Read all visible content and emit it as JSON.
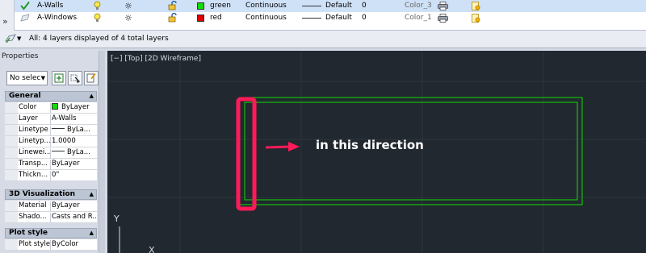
{
  "layers_table": {
    "rows": [
      {
        "name": "A-Walls",
        "color_name": "green",
        "color_hex": "#11dd00",
        "linetype": "Continuous",
        "lineweight": "Default",
        "transparency": "0",
        "plot_style": "Color_3",
        "current": true
      },
      {
        "name": "A-Windows",
        "color_name": "red",
        "color_hex": "#e00000",
        "linetype": "Continuous",
        "lineweight": "Default",
        "transparency": "0",
        "plot_style": "Color_1",
        "current": false
      }
    ],
    "status_text": "All: 4 layers displayed of 4 total layers"
  },
  "properties": {
    "title": "Properties",
    "selection": "No selec",
    "sections": [
      {
        "title": "General",
        "rows": [
          {
            "name": "Color",
            "value": "ByLayer"
          },
          {
            "name": "Layer",
            "value": "A-Walls"
          },
          {
            "name": "Linetype",
            "value": "ByLa..."
          },
          {
            "name": "Linetyp...",
            "value": "1.0000"
          },
          {
            "name": "Linewei...",
            "value": "ByLa..."
          },
          {
            "name": "Transp...",
            "value": "ByLayer"
          },
          {
            "name": "Thickn...",
            "value": "0\""
          }
        ]
      },
      {
        "title": "3D Visualization",
        "rows": [
          {
            "name": "Material",
            "value": "ByLayer"
          },
          {
            "name": "Shado...",
            "value": "Casts and R..."
          }
        ]
      },
      {
        "title": "Plot style",
        "rows": [
          {
            "name": "Plot style",
            "value": "ByColor"
          }
        ]
      }
    ]
  },
  "viewport": {
    "label": "[−] [Top] [2D Wireframe]",
    "annotation": "in this direction",
    "axis_y": "Y",
    "axis_x": "X",
    "line_color": "#11dd00",
    "highlight_color": "#ff1a5a"
  }
}
